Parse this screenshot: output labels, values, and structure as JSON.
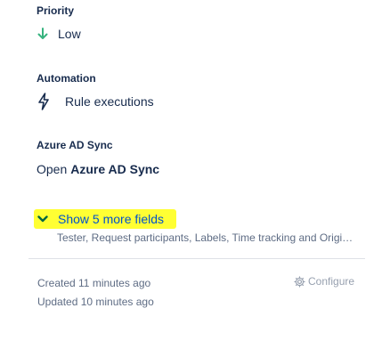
{
  "priority": {
    "label": "Priority",
    "value": "Low",
    "icon": "arrow-down-icon",
    "icon_color": "#36b37e"
  },
  "automation": {
    "label": "Automation",
    "link_text": "Rule executions",
    "icon": "lightning-bolt-icon"
  },
  "azure_ad_sync": {
    "label": "Azure AD Sync",
    "open_prefix": "Open",
    "open_target": "Azure AD Sync"
  },
  "more_fields": {
    "toggle_label": "Show 5 more fields",
    "highlight_color": "#ffff33",
    "fields_summary": "Tester, Request participants, Labels, Time tracking and Origi…"
  },
  "footer": {
    "created": "Created 11 minutes ago",
    "updated": "Updated 10 minutes ago",
    "configure_label": "Configure",
    "configure_icon": "gear-icon"
  }
}
